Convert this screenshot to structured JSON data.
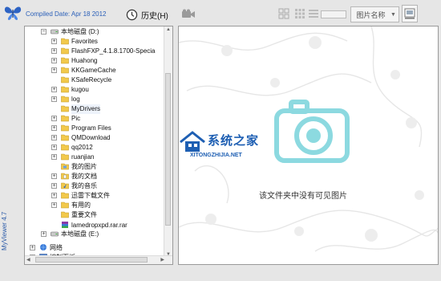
{
  "header": {
    "compiled_date": "Compiled Date: Apr 18 2012",
    "history_label": "历史(H)",
    "sort_select_value": "图片名称"
  },
  "app_title": "MyViewer 4.7",
  "tree": [
    {
      "label": "本地磁盘 (D:)",
      "icon": "drive-icon",
      "expander": "minus"
    },
    {
      "label": "Favorites",
      "icon": "folder-icon",
      "expander": "plus"
    },
    {
      "label": "FlashFXP_4.1.8.1700-Specia",
      "icon": "folder-icon",
      "expander": "plus"
    },
    {
      "label": "Huahong",
      "icon": "folder-icon",
      "expander": "plus"
    },
    {
      "label": "KKGameCache",
      "icon": "folder-icon",
      "expander": "plus"
    },
    {
      "label": "KSafeRecycle",
      "icon": "folder-icon",
      "expander": "none"
    },
    {
      "label": "kugou",
      "icon": "folder-icon",
      "expander": "plus"
    },
    {
      "label": "log",
      "icon": "folder-icon",
      "expander": "plus"
    },
    {
      "label": "MyDrivers",
      "icon": "folder-icon",
      "expander": "none"
    },
    {
      "label": "Pic",
      "icon": "folder-icon",
      "expander": "plus"
    },
    {
      "label": "Program Files",
      "icon": "folder-icon",
      "expander": "plus"
    },
    {
      "label": "QMDownload",
      "icon": "folder-icon",
      "expander": "plus"
    },
    {
      "label": "qq2012",
      "icon": "folder-icon",
      "expander": "plus"
    },
    {
      "label": "ruanjian",
      "icon": "folder-icon",
      "expander": "plus"
    },
    {
      "label": "我的图片",
      "icon": "pictures-icon",
      "expander": "none"
    },
    {
      "label": "我的文档",
      "icon": "documents-icon",
      "expander": "plus"
    },
    {
      "label": "我的音乐",
      "icon": "music-icon",
      "expander": "plus"
    },
    {
      "label": "迅雷下载文件",
      "icon": "folder-icon",
      "expander": "plus"
    },
    {
      "label": "有用的",
      "icon": "folder-icon",
      "expander": "plus"
    },
    {
      "label": "重要文件",
      "icon": "folder-icon",
      "expander": "none"
    },
    {
      "label": "lamedropxpd.rar.rar",
      "icon": "archive-icon",
      "expander": "none"
    },
    {
      "label": "本地磁盘 (E:)",
      "icon": "drive-icon",
      "expander": "plus"
    },
    {
      "label": "网络",
      "icon": "network-icon",
      "expander": "plus"
    },
    {
      "label": "控制面板",
      "icon": "control-panel-icon",
      "expander": "plus"
    }
  ],
  "preview": {
    "empty_message": "该文件夹中没有可见图片"
  },
  "watermark": {
    "name": "系统之家",
    "url": "XITONGZHIJIA.NET"
  },
  "colors": {
    "accent": "#2a5fb8",
    "folder": "#f2c94c",
    "watermark": "#66cdd6"
  }
}
